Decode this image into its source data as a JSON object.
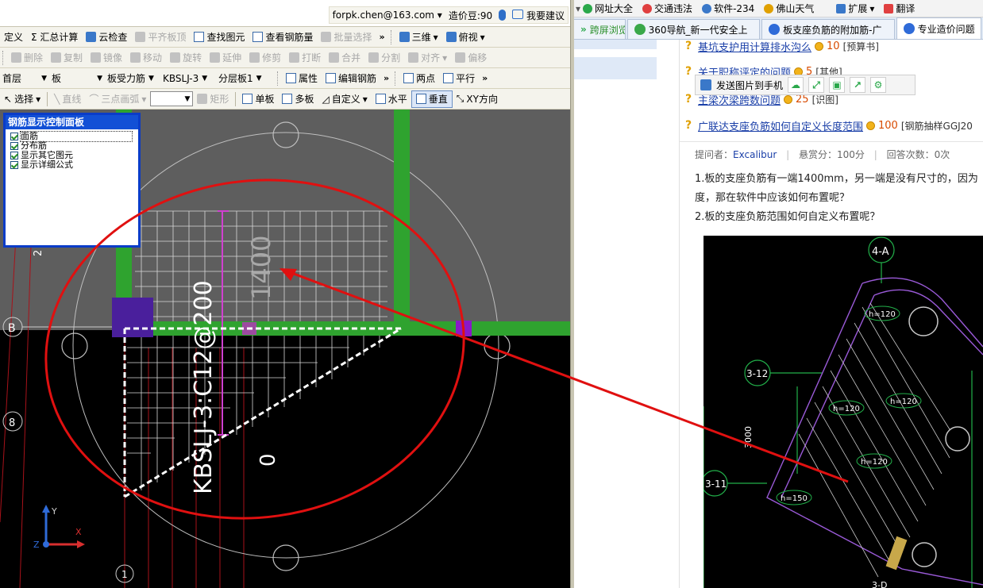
{
  "user_bar": {
    "email": "forpk.chen@163.com",
    "beans": "造价豆:90",
    "suggest": "我要建议"
  },
  "toolbar1": {
    "define": "定义",
    "sum": "Σ 汇总计算",
    "cloud_check": "云检查",
    "flush_slab": "平齐板顶",
    "find_elem": "查找图元",
    "view_rebar": "查看钢筋量",
    "batch_select": "批量选择",
    "more": "»",
    "view3d": "三维",
    "topview": "俯视"
  },
  "toolbar2": {
    "delete": "删除",
    "copy": "复制",
    "mirror": "镜像",
    "move": "移动",
    "rotate": "旋转",
    "extend": "延伸",
    "trim": "修剪",
    "break": "打断",
    "merge": "合并",
    "split": "分割",
    "align": "对齐",
    "offset": "偏移"
  },
  "toolbar3": {
    "floor": "首层",
    "element": "板",
    "rebar_type": "板受力筋",
    "rebar_name": "KBSLJ-3",
    "layer": "分层板1",
    "properties": "属性",
    "edit_rebar": "编辑钢筋",
    "two_points": "两点",
    "parallel": "平行"
  },
  "toolbar4": {
    "select": "选择",
    "line": "直线",
    "arc3": "三点画弧",
    "rect": "矩形",
    "single_slab": "单板",
    "multi_slab": "多板",
    "custom": "自定义",
    "horizontal": "水平",
    "vertical": "垂直",
    "xy_dir": "XY方向"
  },
  "rebar_panel": {
    "title": "钢筋显示控制面板",
    "items": [
      "面筋",
      "分布筋",
      "显示其它图元",
      "显示详细公式"
    ]
  },
  "canvas": {
    "dim_label": "1400",
    "rebar_label": "KBSLJ-3:C12@200",
    "zero_label": "0",
    "axis_b": "B",
    "axis_8": "8",
    "axis_2": "2",
    "axis_1": "1",
    "axis_y": "Y",
    "axis_x": "X",
    "axis_z": "Z"
  },
  "browser": {
    "bookmarks": [
      "网址大全",
      "交通违法",
      "软件-234",
      "佛山天气",
      "扩展",
      "翻译"
    ],
    "tabs": [
      "跨屏浏览",
      "360导航_新一代安全上",
      "板支座负筋的附加筋-广",
      "专业造价问题"
    ],
    "send_to_phone": "发送图片到手机",
    "questions": [
      {
        "title": "基坑支护用计算排水沟么",
        "score": "10",
        "category": "[预算书]"
      },
      {
        "title": "关于职称评定的问题",
        "score": "5",
        "category": "[其他]"
      },
      {
        "title": "主梁次梁跨数问题",
        "score": "25",
        "category": "[识图]"
      }
    ],
    "main_question": {
      "title": "广联达支座负筋如何自定义长度范围",
      "score": "100",
      "category": "[钢筋抽样GGJ20"
    },
    "meta": {
      "asker_label": "提问者：",
      "asker": "Excalibur",
      "reward": "悬赏分：100分",
      "answers": "回答次数：0次"
    },
    "body": [
      "1.板的支座负筋有一端1400mm，另一端是没有尺寸的，因为",
      "度，那在软件中应该如何布置呢？",
      "2.板的支座负筋范围如何自定义布置呢？"
    ],
    "drawing_labels": {
      "top": "4-A",
      "left1": "3-12",
      "left2": "3-11",
      "h120a": "h=120",
      "h120b": "h=120",
      "h120c": "h=120",
      "h120d": "h=120",
      "h150": "h=150",
      "dim": "3000",
      "bottom": "3-D"
    }
  }
}
